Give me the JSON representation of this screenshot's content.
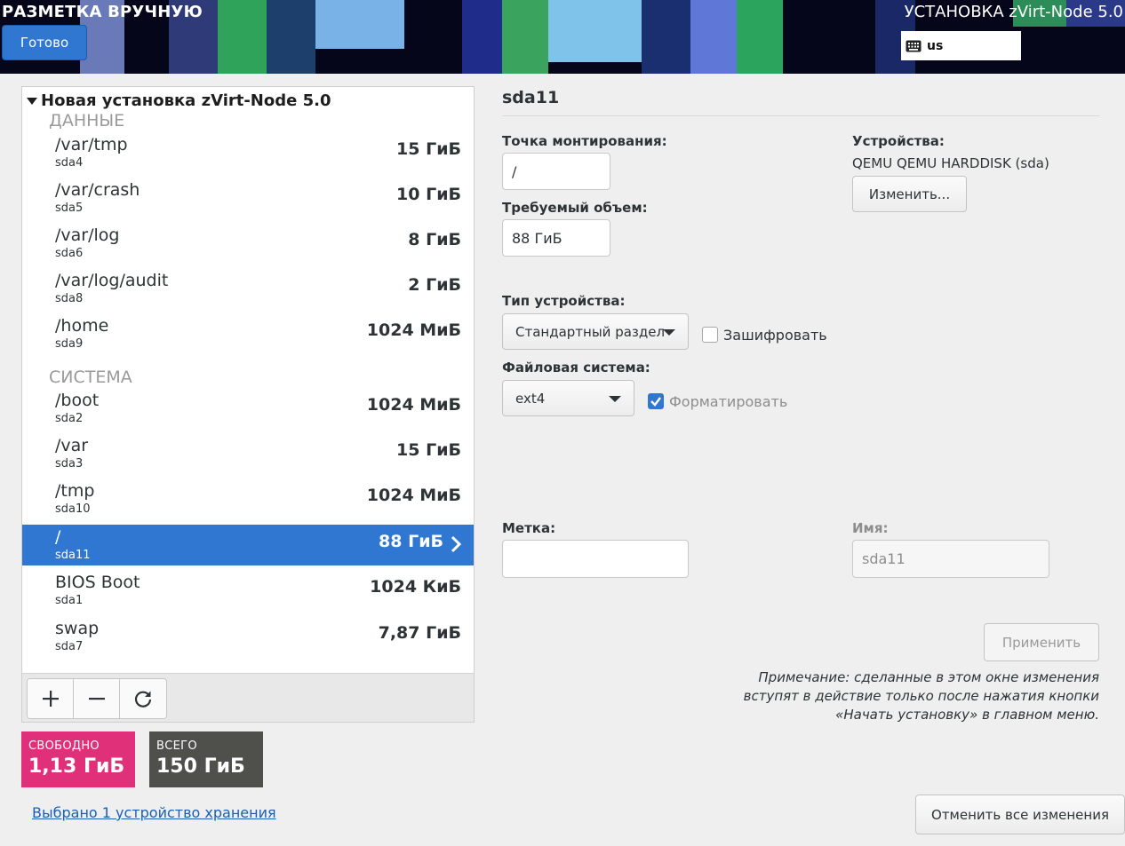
{
  "header": {
    "title": "РАЗМЕТКА ВРУЧНУЮ",
    "done_label": "Готово",
    "installer_title": "УСТАНОВКА zVirt-Node 5.0",
    "keyboard_layout": "us"
  },
  "tree": {
    "root_label": "Новая установка zVirt-Node 5.0",
    "groups": [
      {
        "label": "ДАННЫЕ",
        "items": [
          {
            "mount": "/var/tmp",
            "device": "sda4",
            "size": "15 ГиБ"
          },
          {
            "mount": "/var/crash",
            "device": "sda5",
            "size": "10 ГиБ"
          },
          {
            "mount": "/var/log",
            "device": "sda6",
            "size": "8 ГиБ"
          },
          {
            "mount": "/var/log/audit",
            "device": "sda8",
            "size": "2 ГиБ"
          },
          {
            "mount": "/home",
            "device": "sda9",
            "size": "1024 МиБ"
          }
        ]
      },
      {
        "label": "СИСТЕМА",
        "items": [
          {
            "mount": "/boot",
            "device": "sda2",
            "size": "1024 МиБ"
          },
          {
            "mount": "/var",
            "device": "sda3",
            "size": "15 ГиБ"
          },
          {
            "mount": "/tmp",
            "device": "sda10",
            "size": "1024 МиБ"
          },
          {
            "mount": "/",
            "device": "sda11",
            "size": "88 ГиБ",
            "selected": true
          },
          {
            "mount": "BIOS Boot",
            "device": "sda1",
            "size": "1024 КиБ"
          },
          {
            "mount": "swap",
            "device": "sda7",
            "size": "7,87 ГиБ"
          }
        ]
      }
    ]
  },
  "toolbar": {
    "add_icon": "plus-icon",
    "remove_icon": "minus-icon",
    "refresh_icon": "refresh-icon"
  },
  "space": {
    "free_label": "СВОБОДНО",
    "free_value": "1,13 ГиБ",
    "total_label": "ВСЕГО",
    "total_value": "150 ГиБ",
    "free_color": "#e0307a",
    "total_color": "#4f4f4c"
  },
  "storage_link": "Выбрано 1 устройство хранения",
  "details": {
    "partition_name": "sda11",
    "mount_point_label": "Точка монтирования:",
    "mount_point_value": "/",
    "capacity_label": "Требуемый объем:",
    "capacity_value": "88 ГиБ",
    "devices_label": "Устройства:",
    "device_name": "QEMU QEMU HARDDISK (sda)",
    "modify_label": "Изменить...",
    "device_type_label": "Тип устройства:",
    "device_type_value": "Стандартный раздел",
    "encrypt_label": "Зашифровать",
    "encrypt_checked": false,
    "filesystem_label": "Файловая система:",
    "filesystem_value": "ext4",
    "format_label": "Форматировать",
    "format_checked": true,
    "label_label": "Метка:",
    "label_value": "",
    "name_label": "Имя:",
    "name_value": "sda11",
    "apply_label": "Применить",
    "note": "Примечание: сделанные в этом окне изменения вступят в действие только после нажатия кнопки «Начать установку» в главном меню.",
    "reset_label": "Отменить все изменения"
  },
  "colors": {
    "accent": "#2f77d0",
    "link": "#1a5fb4"
  }
}
